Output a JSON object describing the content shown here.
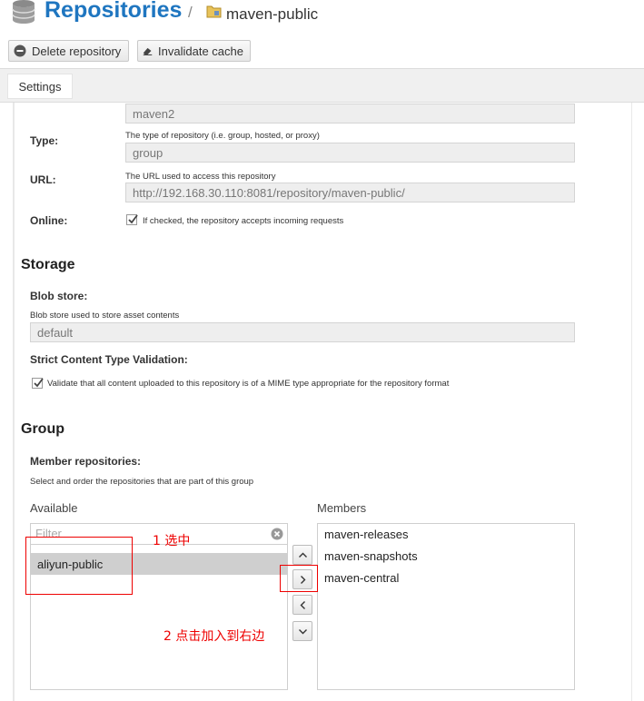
{
  "header": {
    "title": "Repositories",
    "separator": "/",
    "repo_name": "maven-public"
  },
  "toolbar": {
    "delete_label": "Delete repository",
    "invalidate_label": "Invalidate cache"
  },
  "tabs": [
    {
      "label": "Settings",
      "active": true
    }
  ],
  "form": {
    "format_value": "maven2",
    "type": {
      "label": "Type:",
      "help": "The type of repository (i.e. group, hosted, or proxy)",
      "value": "group"
    },
    "url": {
      "label": "URL:",
      "help": "The URL used to access this repository",
      "value": "http://192.168.30.110:8081/repository/maven-public/"
    },
    "online": {
      "label": "Online:",
      "checkbox_text": "If checked, the repository accepts incoming requests",
      "checked": true
    }
  },
  "storage": {
    "heading": "Storage",
    "blob_label": "Blob store:",
    "blob_help": "Blob store used to store asset contents",
    "blob_value": "default",
    "strict_label": "Strict Content Type Validation:",
    "strict_text": "Validate that all content uploaded to this repository is of a MIME type appropriate for the repository format",
    "strict_checked": true
  },
  "group": {
    "heading": "Group",
    "member_label": "Member repositories:",
    "member_help": "Select and order the repositories that are part of this group",
    "available_label": "Available",
    "members_label": "Members",
    "filter_placeholder": "Filter",
    "available": [
      "aliyun-public"
    ],
    "members": [
      "maven-releases",
      "maven-snapshots",
      "maven-central"
    ]
  },
  "annotations": {
    "step1": "1 选中",
    "step2": "2 点击加入到右边",
    "color": "#e00000"
  },
  "colors": {
    "title": "#1f76c0"
  }
}
